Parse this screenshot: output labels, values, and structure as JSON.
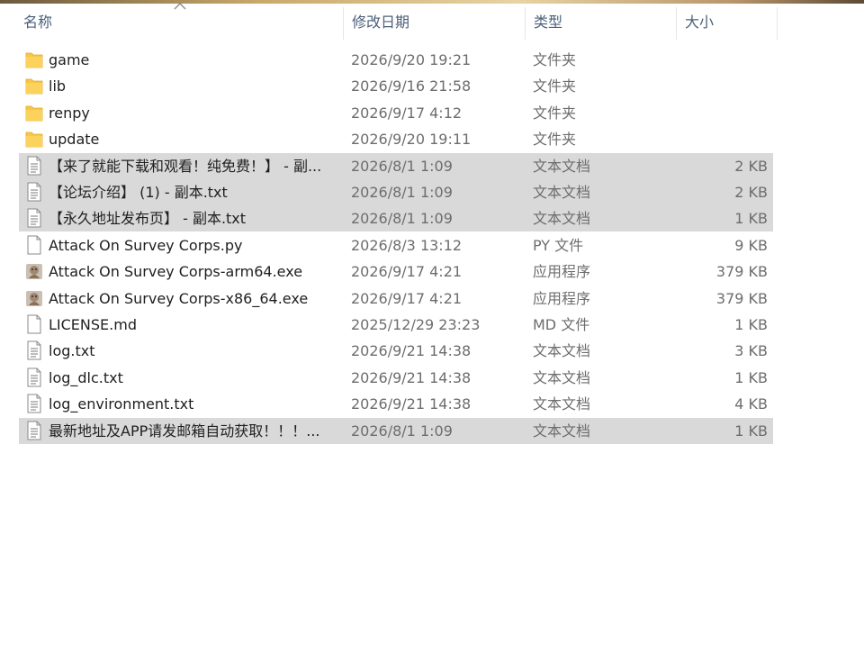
{
  "header": {
    "name": "名称",
    "modified": "修改日期",
    "type": "类型",
    "size": "大小"
  },
  "files": [
    {
      "name": "game",
      "modified": "2026/9/20 19:21",
      "type": "文件夹",
      "size": "",
      "icon": "folder-icon",
      "selected": false
    },
    {
      "name": "lib",
      "modified": "2026/9/16 21:58",
      "type": "文件夹",
      "size": "",
      "icon": "folder-icon",
      "selected": false
    },
    {
      "name": "renpy",
      "modified": "2026/9/17 4:12",
      "type": "文件夹",
      "size": "",
      "icon": "folder-icon",
      "selected": false
    },
    {
      "name": "update",
      "modified": "2026/9/20 19:11",
      "type": "文件夹",
      "size": "",
      "icon": "folder-icon",
      "selected": false
    },
    {
      "name": "【来了就能下载和观看！纯免费！】 - 副...",
      "modified": "2026/8/1 1:09",
      "type": "文本文档",
      "size": "2 KB",
      "icon": "text-document-icon",
      "selected": true
    },
    {
      "name": "【论坛介绍】 (1) - 副本.txt",
      "modified": "2026/8/1 1:09",
      "type": "文本文档",
      "size": "2 KB",
      "icon": "text-document-icon",
      "selected": true
    },
    {
      "name": "【永久地址发布页】 - 副本.txt",
      "modified": "2026/8/1 1:09",
      "type": "文本文档",
      "size": "1 KB",
      "icon": "text-document-icon",
      "selected": true
    },
    {
      "name": "Attack On Survey Corps.py",
      "modified": "2026/8/3 13:12",
      "type": "PY 文件",
      "size": "9 KB",
      "icon": "blank-file-icon",
      "selected": false
    },
    {
      "name": "Attack On Survey Corps-arm64.exe",
      "modified": "2026/9/17 4:21",
      "type": "应用程序",
      "size": "379 KB",
      "icon": "application-icon",
      "selected": false
    },
    {
      "name": "Attack On Survey Corps-x86_64.exe",
      "modified": "2026/9/17 4:21",
      "type": "应用程序",
      "size": "379 KB",
      "icon": "application-icon",
      "selected": false
    },
    {
      "name": "LICENSE.md",
      "modified": "2025/12/29 23:23",
      "type": "MD 文件",
      "size": "1 KB",
      "icon": "blank-file-icon",
      "selected": false
    },
    {
      "name": "log.txt",
      "modified": "2026/9/21 14:38",
      "type": "文本文档",
      "size": "3 KB",
      "icon": "text-document-icon",
      "selected": false
    },
    {
      "name": "log_dlc.txt",
      "modified": "2026/9/21 14:38",
      "type": "文本文档",
      "size": "1 KB",
      "icon": "text-document-icon",
      "selected": false
    },
    {
      "name": "log_environment.txt",
      "modified": "2026/9/21 14:38",
      "type": "文本文档",
      "size": "4 KB",
      "icon": "text-document-icon",
      "selected": false
    },
    {
      "name": "最新地址及APP请发邮箱自动获取！！！...",
      "modified": "2026/8/1 1:09",
      "type": "文本文档",
      "size": "1 KB",
      "icon": "text-document-icon",
      "selected": true
    }
  ],
  "colors": {
    "selected_row": "#d9d9d9",
    "folder": "#f7c64a",
    "header_text": "#4c607a"
  }
}
